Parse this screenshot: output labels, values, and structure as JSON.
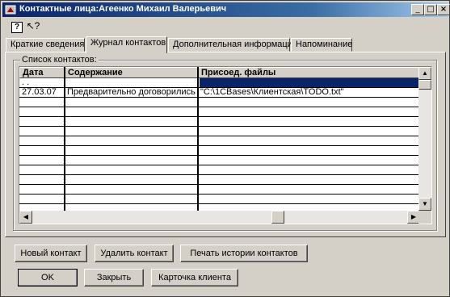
{
  "window": {
    "title": "Контактные лица:Агеенко Михаил Валерьевич",
    "controls": [
      "_",
      "□",
      "×"
    ]
  },
  "toolbar": {
    "help_icon": "?",
    "whatis_icon": "↖?"
  },
  "tabs": [
    {
      "label": "Краткие сведения",
      "active": false
    },
    {
      "label": "Журнал контактов",
      "active": true
    },
    {
      "label": "Дополнительная информация",
      "active": false
    },
    {
      "label": "Напоминание",
      "active": false
    }
  ],
  "contacts": {
    "group_label": "Список контактов:",
    "columns": [
      "Дата",
      "Содержание",
      "Присоед. файлы"
    ],
    "rows": [
      {
        "date": ". .",
        "content": "",
        "files": "",
        "selected": true
      },
      {
        "date": "27.03.07",
        "content": "Предварительно договорились о",
        "files": "\"C:\\1CBases\\Клиентская\\TODO.txt\"",
        "selected": false
      }
    ]
  },
  "actions": {
    "new_contact": "Новый контакт",
    "delete_contact": "Удалить контакт",
    "print_history": "Печать истории контактов"
  },
  "footer": {
    "ok": "OK",
    "close": "Закрыть",
    "client_card": "Карточка клиента"
  },
  "colors": {
    "title_bar": "#0a246a",
    "face": "#d4d0c8",
    "selection": "#0a246a"
  }
}
